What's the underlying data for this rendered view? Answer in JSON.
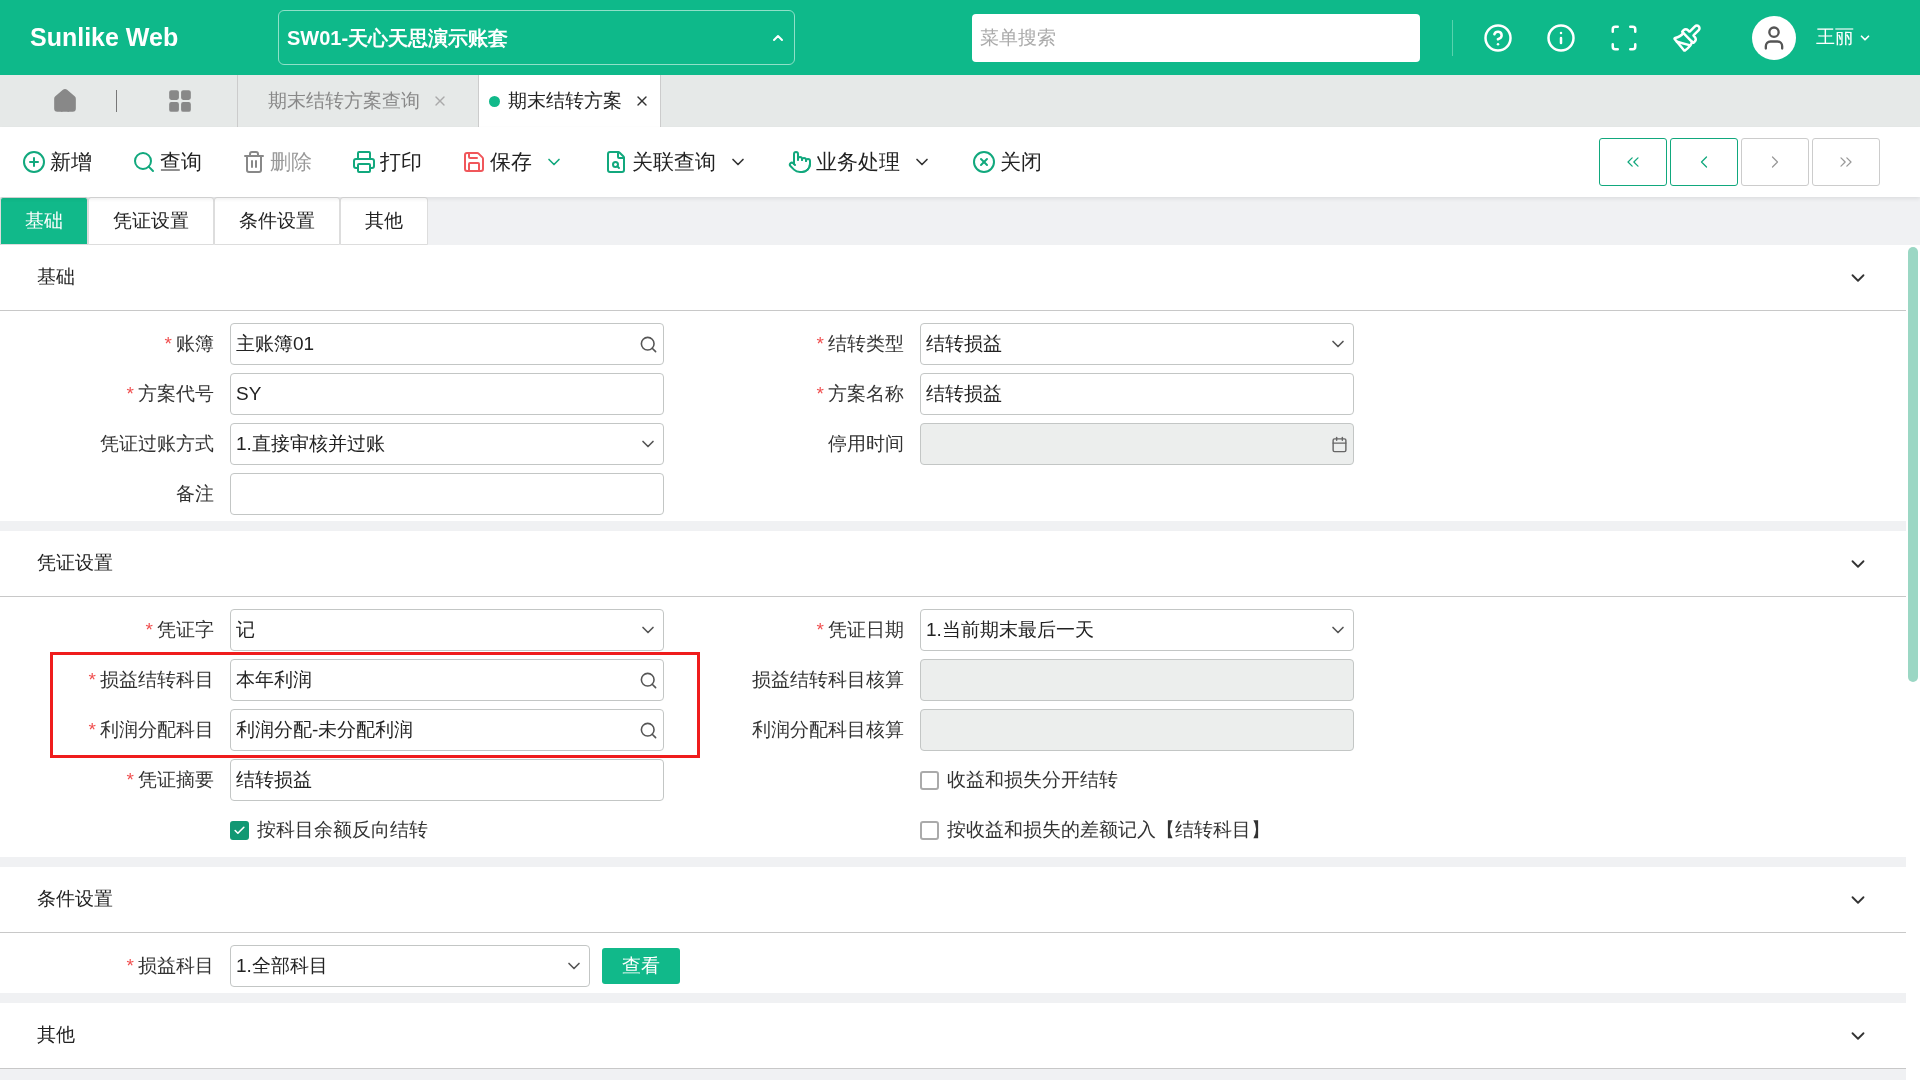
{
  "header": {
    "logo": "Sunlike Web",
    "account": "SW01-天心天思演示账套",
    "search": {
      "placeholder": "菜单搜索"
    },
    "user": "王丽"
  },
  "page_tabs": [
    {
      "label": "期末结转方案查询",
      "selected": false
    },
    {
      "label": "期末结转方案",
      "selected": true
    }
  ],
  "toolbar": [
    {
      "kind": "add",
      "label": "新增",
      "disabled": false,
      "dropdown": false
    },
    {
      "kind": "search",
      "label": "查询",
      "disabled": false,
      "dropdown": false
    },
    {
      "kind": "delete",
      "label": "删除",
      "disabled": true,
      "dropdown": false
    },
    {
      "kind": "print",
      "label": "打印",
      "disabled": false,
      "dropdown": false
    },
    {
      "kind": "save",
      "label": "保存",
      "disabled": false,
      "dropdown": true
    },
    {
      "kind": "related",
      "label": "关联查询",
      "disabled": false,
      "dropdown": true
    },
    {
      "kind": "process",
      "label": "业务处理",
      "disabled": false,
      "dropdown": true
    },
    {
      "kind": "close",
      "label": "关闭",
      "disabled": false,
      "dropdown": false
    }
  ],
  "nav_buttons": [
    {
      "kind": "first",
      "disabled": false
    },
    {
      "kind": "prev",
      "disabled": false
    },
    {
      "kind": "next",
      "disabled": true
    },
    {
      "kind": "last",
      "disabled": true
    }
  ],
  "form_tabs": [
    {
      "label": "基础",
      "selected": true
    },
    {
      "label": "凭证设置",
      "selected": false
    },
    {
      "label": "条件设置",
      "selected": false
    },
    {
      "label": "其他",
      "selected": false
    }
  ],
  "sections": [
    {
      "title": "基础",
      "expanded": true,
      "left": [
        {
          "kind": "lookup",
          "mark": "*",
          "label": "账簿",
          "highlighted": false,
          "value": "主账簿01"
        },
        {
          "kind": "text",
          "mark": "*",
          "label": "方案代号",
          "highlighted": false,
          "value": "SY"
        },
        {
          "kind": "select",
          "label": "凭证过账方式",
          "highlighted": false,
          "value": "1.直接审核并过账"
        },
        {
          "kind": "text",
          "label": "备注",
          "highlighted": false
        }
      ],
      "right": [
        {
          "kind": "select",
          "mark": "*",
          "label": "结转类型",
          "value": "结转损益"
        },
        {
          "kind": "text",
          "mark": "*",
          "label": "方案名称",
          "value": "结转损益"
        },
        {
          "kind": "date",
          "label": "停用时间",
          "disabled": true
        }
      ]
    },
    {
      "title": "凭证设置",
      "expanded": true,
      "left": [
        {
          "kind": "select",
          "mark": "*",
          "label": "凭证字",
          "highlighted": false,
          "value": "记"
        },
        {
          "kind": "lookup",
          "mark": "*",
          "label": "损益结转科目",
          "highlighted": true,
          "value": "本年利润"
        },
        {
          "kind": "lookup",
          "mark": "*",
          "label": "利润分配科目",
          "highlighted": true,
          "value": "利润分配-未分配利润"
        },
        {
          "kind": "text",
          "mark": "*",
          "label": "凭证摘要",
          "highlighted": false,
          "value": "结转损益"
        },
        {
          "kind": "checkbox",
          "label": "按科目余额反向结转",
          "checked": true,
          "highlighted": false
        }
      ],
      "right": [
        {
          "kind": "select",
          "mark": "*",
          "label": "凭证日期",
          "value": "1.当前期末最后一天"
        },
        {
          "kind": "text",
          "label": "损益结转科目核算",
          "disabled": true
        },
        {
          "kind": "text",
          "label": "利润分配科目核算",
          "disabled": true
        },
        {
          "kind": "checkbox",
          "label": "收益和损失分开结转",
          "checked": false
        },
        {
          "kind": "checkbox",
          "label": "按收益和损失的差额记入【结转科目】",
          "checked": false
        }
      ]
    },
    {
      "title": "条件设置",
      "expanded": true,
      "left": [
        {
          "kind": "select",
          "mark": "*",
          "label": "损益科目",
          "highlighted": false,
          "value": "1.全部科目",
          "button": "查看"
        }
      ]
    },
    {
      "title": "其他",
      "expanded": true
    }
  ]
}
